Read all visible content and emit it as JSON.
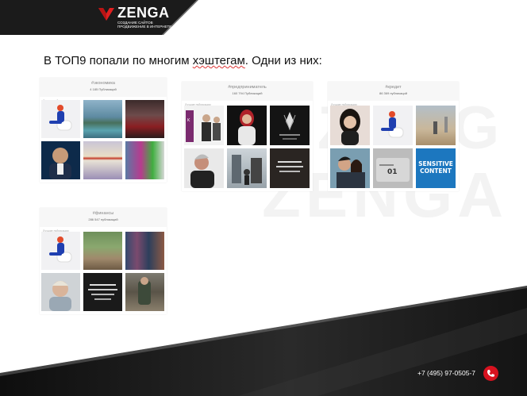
{
  "brand": {
    "name": "ZENGA",
    "tagline": "СОЗДАНИЕ САЙТОВ ПРОДВИЖЕНИЕ В ИНТЕРНЕТЕ"
  },
  "headline": {
    "text_before": "В ТОП9 попали по многим ",
    "text_underlined": "хэштегам",
    "text_after": ". Одни из них:"
  },
  "watermark": {
    "line1": "ZENG",
    "line2": "ZENGA"
  },
  "panels": [
    {
      "hashtag": "#экономика",
      "count": "4 185 Публикаций",
      "label": "Лучшие публикации"
    },
    {
      "hashtag": "#предприниматель",
      "count": "160 794 Публикаций",
      "label": "Лучшие публикации"
    },
    {
      "hashtag": "#кредит",
      "count": "86 369 публикаций",
      "label": "Лучшие публикации"
    },
    {
      "hashtag": "#финансы",
      "count": "286 547 публикаций",
      "label": "Лучшие публикации"
    }
  ],
  "thumb_texts": {
    "sensitive": "SENSITIVE\nCONTENT",
    "forum": "ОЛИМПИЙСКИЙ ФОРУМ"
  },
  "contact": {
    "phone": "+7 (495) 97-0505-7"
  },
  "colors": {
    "accent": "#d8121f",
    "dark": "#1b1b1b"
  },
  "icons": {
    "call": "phone-icon",
    "logo": "zenga-chevron-logo"
  }
}
